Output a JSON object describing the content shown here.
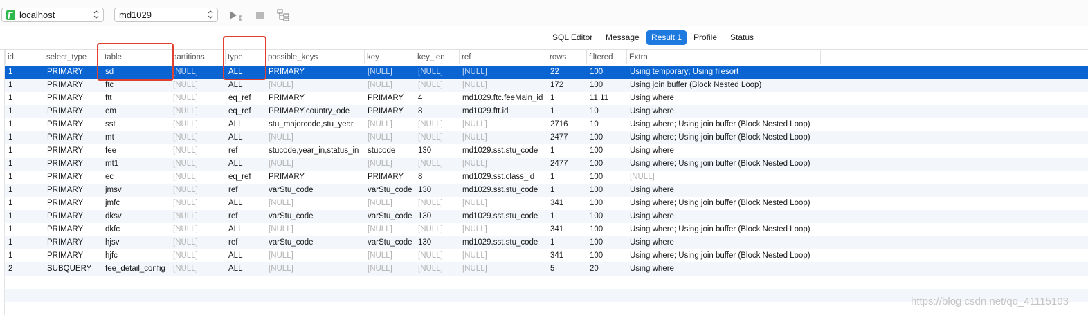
{
  "toolbar": {
    "connection": "localhost",
    "database": "md1029"
  },
  "tabs": [
    "SQL Editor",
    "Message",
    "Result 1",
    "Profile",
    "Status"
  ],
  "active_tab": "Result 1",
  "columns": [
    "id",
    "select_type",
    "table",
    "partitions",
    "type",
    "possible_keys",
    "key",
    "key_len",
    "ref",
    "rows",
    "filtered",
    "Extra"
  ],
  "rows": [
    [
      "1",
      "PRIMARY",
      "sd",
      "[NULL]",
      "ALL",
      "PRIMARY",
      "[NULL]",
      "[NULL]",
      "[NULL]",
      "22",
      "100",
      "Using temporary; Using filesort"
    ],
    [
      "1",
      "PRIMARY",
      "ftc",
      "[NULL]",
      "ALL",
      "[NULL]",
      "[NULL]",
      "[NULL]",
      "[NULL]",
      "172",
      "100",
      "Using join buffer (Block Nested Loop)"
    ],
    [
      "1",
      "PRIMARY",
      "ftt",
      "[NULL]",
      "eq_ref",
      "PRIMARY",
      "PRIMARY",
      "4",
      "md1029.ftc.feeMain_id",
      "1",
      "11.11",
      "Using where"
    ],
    [
      "1",
      "PRIMARY",
      "em",
      "[NULL]",
      "eq_ref",
      "PRIMARY,country_ode",
      "PRIMARY",
      "8",
      "md1029.ftt.id",
      "1",
      "10",
      "Using where"
    ],
    [
      "1",
      "PRIMARY",
      "sst",
      "[NULL]",
      "ALL",
      "stu_majorcode,stu_year",
      "[NULL]",
      "[NULL]",
      "[NULL]",
      "2716",
      "10",
      "Using where; Using join buffer (Block Nested Loop)"
    ],
    [
      "1",
      "PRIMARY",
      "mt",
      "[NULL]",
      "ALL",
      "[NULL]",
      "[NULL]",
      "[NULL]",
      "[NULL]",
      "2477",
      "100",
      "Using where; Using join buffer (Block Nested Loop)"
    ],
    [
      "1",
      "PRIMARY",
      "fee",
      "[NULL]",
      "ref",
      "stucode,year_in,status_in",
      "stucode",
      "130",
      "md1029.sst.stu_code",
      "1",
      "100",
      "Using where"
    ],
    [
      "1",
      "PRIMARY",
      "mt1",
      "[NULL]",
      "ALL",
      "[NULL]",
      "[NULL]",
      "[NULL]",
      "[NULL]",
      "2477",
      "100",
      "Using where; Using join buffer (Block Nested Loop)"
    ],
    [
      "1",
      "PRIMARY",
      "ec",
      "[NULL]",
      "eq_ref",
      "PRIMARY",
      "PRIMARY",
      "8",
      "md1029.sst.class_id",
      "1",
      "100",
      "[NULL]"
    ],
    [
      "1",
      "PRIMARY",
      "jmsv",
      "[NULL]",
      "ref",
      "varStu_code",
      "varStu_code",
      "130",
      "md1029.sst.stu_code",
      "1",
      "100",
      "Using where"
    ],
    [
      "1",
      "PRIMARY",
      "jmfc",
      "[NULL]",
      "ALL",
      "[NULL]",
      "[NULL]",
      "[NULL]",
      "[NULL]",
      "341",
      "100",
      "Using where; Using join buffer (Block Nested Loop)"
    ],
    [
      "1",
      "PRIMARY",
      "dksv",
      "[NULL]",
      "ref",
      "varStu_code",
      "varStu_code",
      "130",
      "md1029.sst.stu_code",
      "1",
      "100",
      "Using where"
    ],
    [
      "1",
      "PRIMARY",
      "dkfc",
      "[NULL]",
      "ALL",
      "[NULL]",
      "[NULL]",
      "[NULL]",
      "[NULL]",
      "341",
      "100",
      "Using where; Using join buffer (Block Nested Loop)"
    ],
    [
      "1",
      "PRIMARY",
      "hjsv",
      "[NULL]",
      "ref",
      "varStu_code",
      "varStu_code",
      "130",
      "md1029.sst.stu_code",
      "1",
      "100",
      "Using where"
    ],
    [
      "1",
      "PRIMARY",
      "hjfc",
      "[NULL]",
      "ALL",
      "[NULL]",
      "[NULL]",
      "[NULL]",
      "[NULL]",
      "341",
      "100",
      "Using where; Using join buffer (Block Nested Loop)"
    ],
    [
      "2",
      "SUBQUERY",
      "fee_detail_config",
      "[NULL]",
      "ALL",
      "[NULL]",
      "[NULL]",
      "[NULL]",
      "[NULL]",
      "5",
      "20",
      "Using where"
    ]
  ],
  "selected_row": 0,
  "watermark": "https://blog.csdn.net/qq_41115103",
  "colors": {
    "selection": "#0a64d2",
    "active_tab": "#1f7ae0",
    "annotation": "#e0402f",
    "null_text": "#b4b4b4"
  },
  "icons": {
    "connection": "database-icon",
    "run": "play-icon",
    "stop": "stop-icon",
    "explain": "visual-explain-icon"
  }
}
